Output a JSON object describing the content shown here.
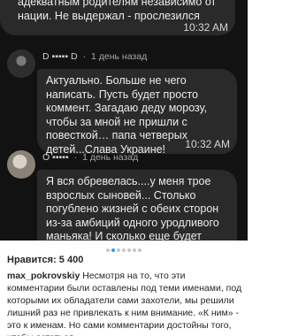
{
  "comments": [
    {
      "lines": [
        "адекватным родителям независимо от",
        "нации. Не выдержал - прослезился"
      ],
      "time": "10:32 AM"
    },
    {
      "username": "D",
      "username_suffix": "D",
      "meta": "1 день назад",
      "body": "Актуально. Больше не чего написать. Пусть будет просто коммент. Загадаю деду морозу, чтобы за мной не пришли с повесткой… папа четверых детей...Слава Украине!",
      "time": "10:32 AM",
      "avatar": "avatar-dark"
    },
    {
      "username": "О",
      "meta": "1 день назад",
      "body": "Я вся обревелась....у меня трое взрослых сыновей... Столько погублено жизней с обеих сторон из-за амбиций одного уродливого маньяка! И сколько еще будет",
      "avatar": "avatar-light"
    }
  ],
  "post": {
    "likes": "Нравится: 5 400",
    "username": "max_pokrovskiy",
    "caption": "Несмотря на то, что эти комментарии были оставлены под теми именами, под которыми их обладатели сами захотели, мы решили лишний раз не привлекать к ним внимание. «К ним» - это к именам. Но сами комментарии достойны того, чтобы остаться",
    "carousel": {
      "count": 7,
      "active_index": 1
    }
  },
  "colors": {
    "dark_bg": "#121212",
    "bubble": "#2a2a2b",
    "active_dot": "#3897f0"
  }
}
